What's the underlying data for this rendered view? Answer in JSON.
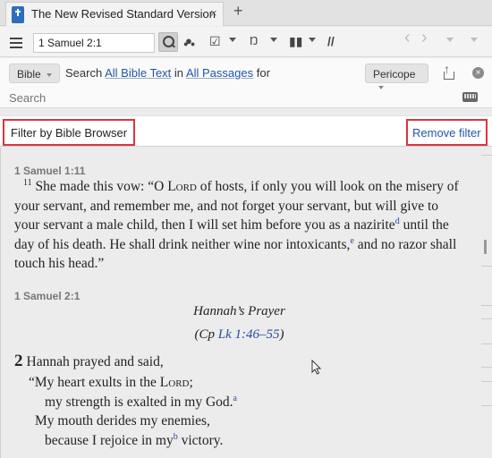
{
  "tab": {
    "title": "The New Revised Standard Version",
    "close_glyph": "×",
    "add_glyph": "+"
  },
  "toolbar": {
    "reference_value": "1 Samuel 2:1",
    "icons": [
      "menu-icon",
      "search-icon",
      "visual-filter-icon",
      "checklist-icon",
      "interlinear-icon",
      "columns-icon",
      "parallel-icon",
      "back-icon",
      "forward-icon"
    ],
    "parallel_glyph": "//",
    "back_glyph": "‹",
    "forward_glyph": "›"
  },
  "search": {
    "scope_label": "Bible",
    "sentence_prefix": "Search",
    "text_link": "All Bible Text",
    "in_word": "in",
    "passages_link": "All Passages",
    "for_word": "for",
    "pericope_label": "Pericope",
    "input_placeholder": "Search",
    "clear_glyph": "×"
  },
  "filter": {
    "label": "Filter by Bible Browser",
    "remove_label": "Remove filter"
  },
  "passage1": {
    "reference": "1 Samuel 1:11",
    "verse_number": "11",
    "text_a": "She made this vow: “O",
    "lord_a": "Lord",
    "text_b": "of hosts, if only you will look on the misery of your servant, and remember me, and not forget your servant, but will give to your servant a male child, then I will set him before you as a nazirite",
    "note_d": "d",
    "text_c": "until the day of his death. He shall drink neither wine nor intoxicants,",
    "note_e": "e",
    "text_d": "and no razor shall touch his head.”"
  },
  "passage2": {
    "reference": "1 Samuel 2:1",
    "section_title": "Hannah’s Prayer",
    "xref_prefix": "(Cp",
    "xref_link": "Lk 1:46–55",
    "xref_suffix": ")",
    "chapter_number": "2",
    "intro": "Hannah prayed and said,",
    "line1_a": "“My heart exults in the",
    "line1_lord": "Lord",
    "line1_b": ";",
    "line2": "my strength is exalted in my God.",
    "note_a": "a",
    "line3": "My mouth derides my enemies,",
    "line4_a": "because I rejoice in my",
    "note_b": "b",
    "line4_b": "victory."
  }
}
